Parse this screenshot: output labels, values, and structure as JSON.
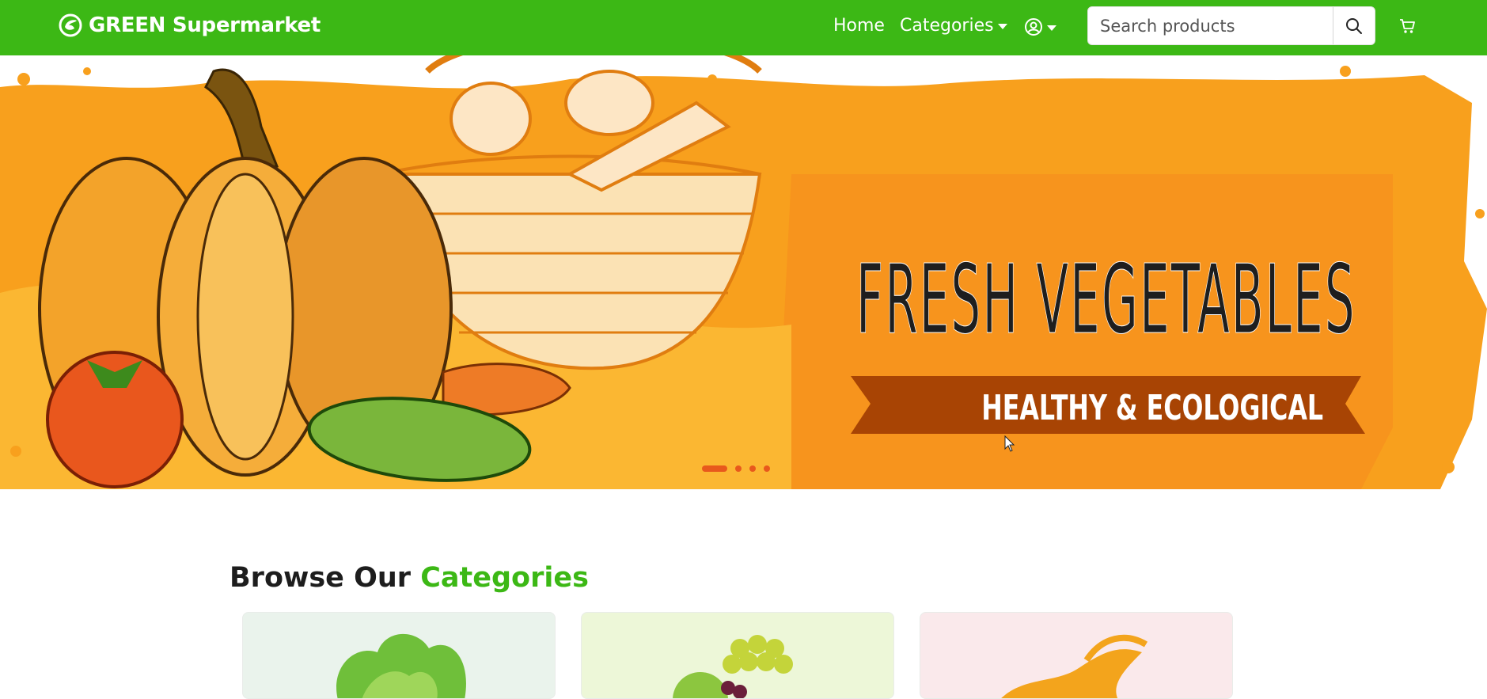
{
  "brand": {
    "name": "GREEN Supermarket"
  },
  "nav": {
    "home_label": "Home",
    "categories_label": "Categories"
  },
  "search": {
    "placeholder": "Search products"
  },
  "icons": {
    "logo": "leaf-logo-icon",
    "user": "user-circle-icon",
    "search": "search-icon",
    "cart": "cart-icon"
  },
  "hero": {
    "title": "FRESH VEGETABLES",
    "subtitle": "HEALTHY & ECOLOGICAL",
    "slide_count": 4,
    "active_slide": 1
  },
  "categories_section": {
    "title_prefix": "Browse Our",
    "title_accent": "Categories"
  },
  "category_cards": [
    {
      "bg": "#eaf3ec"
    },
    {
      "bg": "#edf7d8"
    },
    {
      "bg": "#fae9eb"
    }
  ],
  "colors": {
    "brand_green": "#3cb815",
    "hero_orange": "#f7941d",
    "ribbon_brown": "#a84404"
  }
}
